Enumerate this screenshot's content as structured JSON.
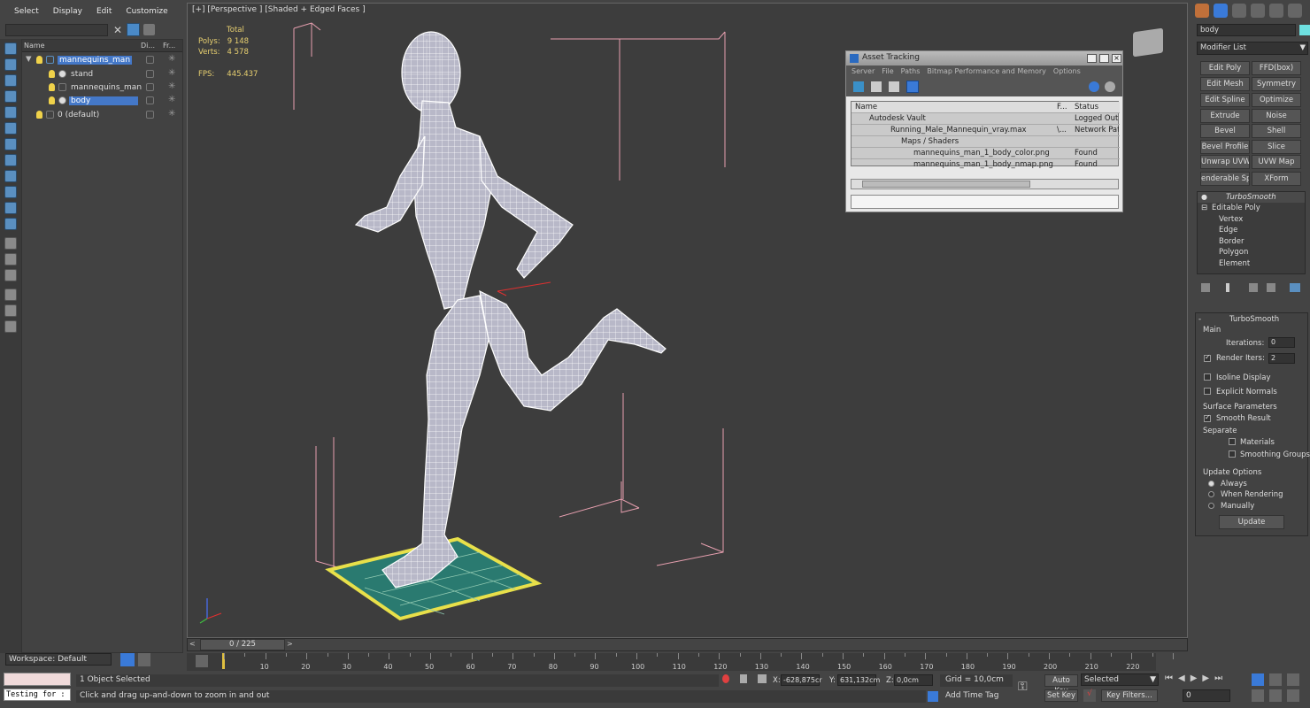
{
  "menu": [
    "Select",
    "Display",
    "Edit",
    "Customize"
  ],
  "explorer": {
    "columns": [
      "Name",
      "Di...",
      "Fr..."
    ],
    "rows": [
      {
        "label": "mannequins_man",
        "selected": true,
        "indent": 1
      },
      {
        "label": "stand",
        "selected": false,
        "indent": 2
      },
      {
        "label": "mannequins_man",
        "selected": false,
        "indent": 2
      },
      {
        "label": "body",
        "selected": true,
        "indent": 2
      },
      {
        "label": "0 (default)",
        "selected": false,
        "indent": 1
      }
    ]
  },
  "viewport": {
    "label": "[+] [Perspective ] [Shaded + Edged Faces ]",
    "stats": {
      "total": "Total",
      "polys_label": "Polys:",
      "polys": "9 148",
      "verts_label": "Verts:",
      "verts": "4 578",
      "fps_label": "FPS:",
      "fps": "445.437"
    }
  },
  "asset_tracking": {
    "title": "Asset Tracking",
    "menu": [
      "Server",
      "File",
      "Paths",
      "Bitmap Performance and Memory",
      "Options"
    ],
    "columns": [
      "Name",
      "F...",
      "Status"
    ],
    "rows": [
      {
        "name": "Autodesk Vault",
        "f": "",
        "status": "Logged Out (",
        "indent": 20
      },
      {
        "name": "Running_Male_Mannequin_vray.max",
        "f": "\\...",
        "status": "Network Path",
        "indent": 34
      },
      {
        "name": "Maps / Shaders",
        "f": "",
        "status": "",
        "indent": 48
      },
      {
        "name": "mannequins_man_1_body_color.png",
        "f": "",
        "status": "Found",
        "indent": 62
      },
      {
        "name": "mannequins_man_1_body_nmap.png",
        "f": "",
        "status": "Found",
        "indent": 62
      }
    ]
  },
  "command_panel": {
    "object_name": "body",
    "modifier_list": "Modifier List",
    "buttons": [
      [
        "Edit Poly",
        "FFD(box)"
      ],
      [
        "Edit Mesh",
        "Symmetry"
      ],
      [
        "Edit Spline",
        "Optimize"
      ],
      [
        "Extrude",
        "Noise"
      ],
      [
        "Bevel",
        "Shell"
      ],
      [
        "Bevel Profile",
        "Slice"
      ],
      [
        "Unwrap UVW",
        "UVW Map"
      ],
      [
        "enderable Splin",
        "XForm"
      ]
    ],
    "stack": [
      "TurboSmooth",
      "Editable Poly",
      "Vertex",
      "Edge",
      "Border",
      "Polygon",
      "Element"
    ]
  },
  "turbosmooth": {
    "title": "TurboSmooth",
    "main": "Main",
    "iterations_label": "Iterations:",
    "iterations": "0",
    "render_iters_label": "Render Iters:",
    "render_iters": "2",
    "isoline": "Isoline Display",
    "explicit": "Explicit Normals",
    "surface": "Surface Parameters",
    "smooth_result": "Smooth Result",
    "separate": "Separate",
    "materials": "Materials",
    "smoothing_groups": "Smoothing Groups",
    "update_options": "Update Options",
    "always": "Always",
    "when_rendering": "When Rendering",
    "manually": "Manually",
    "update": "Update"
  },
  "timeline": {
    "frame": "0 / 225",
    "ticks": [
      "10",
      "20",
      "30",
      "40",
      "50",
      "60",
      "70",
      "80",
      "90",
      "100",
      "110",
      "120",
      "130",
      "140",
      "150",
      "160",
      "170",
      "180",
      "190",
      "200",
      "210",
      "220"
    ]
  },
  "status": {
    "workspace": "Workspace: Default",
    "testing": "Testing for :",
    "objects_selected": "1 Object Selected",
    "prompt": "Click and drag up-and-down to zoom in and out",
    "x_label": "X:",
    "x": "-628,875cr",
    "y_label": "Y:",
    "y": "631,132cm",
    "z_label": "Z:",
    "z": "0,0cm",
    "grid": "Grid = 10,0cm",
    "add_time_tag": "Add Time Tag",
    "auto_key": "Auto Key",
    "set_key": "Set Key",
    "selected": "Selected",
    "key_filters": "Key Filters...",
    "frame_value": "0"
  },
  "colors": {
    "accent": "#4478c8",
    "stats": "#e8d070",
    "mesh": "#ffffff",
    "floor": "#2a7a70",
    "floor_edge": "#e8e04a"
  }
}
